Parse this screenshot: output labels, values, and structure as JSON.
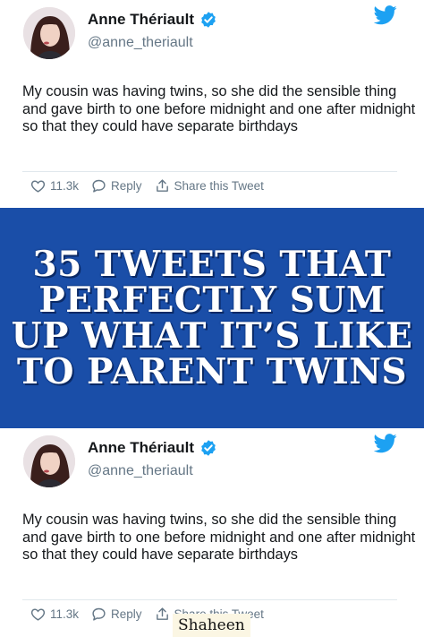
{
  "tweet": {
    "author_name": "Anne Thériault",
    "author_handle": "@anne_theriault",
    "text": "My cousin was having twins, so she did the sensible thing and gave birth to one before midnight and one after midnight so that they could have separate birthdays",
    "likes": "11.3k",
    "reply_label": "Reply",
    "share_label": "Share this Tweet",
    "share_label_partial": "Share this Tweet"
  },
  "banner": {
    "headline": "35 TWEETS THAT PERFECTLY SUM UP WHAT IT’S LIKE TO PARENT TWINS"
  },
  "watermark": "Shaheen",
  "colors": {
    "banner_bg": "#1a4ea8",
    "twitter_blue": "#1da1f2",
    "muted_text": "#657786"
  },
  "icons": [
    "verified-badge-icon",
    "twitter-bird-icon",
    "heart-icon",
    "reply-icon",
    "share-icon"
  ]
}
